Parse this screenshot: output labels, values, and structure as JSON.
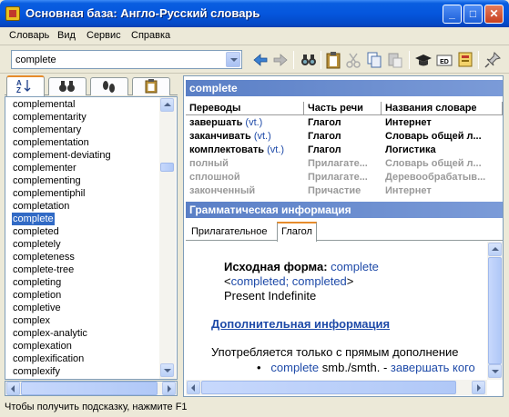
{
  "window": {
    "title": "Основная база: Англо-Русский словарь"
  },
  "menu": [
    "Словарь",
    "Вид",
    "Сервис",
    "Справка"
  ],
  "search": {
    "value": "complete"
  },
  "word_list": [
    "complemental",
    "complementarity",
    "complementary",
    "complementation",
    "complement-deviating",
    "complementer",
    "complementing",
    "complementiphil",
    "completation",
    "complete",
    "completed",
    "completely",
    "completeness",
    "complete-tree",
    "completing",
    "completion",
    "completive",
    "complex",
    "complex-analytic",
    "complexation",
    "complexification",
    "complexify"
  ],
  "selected_word": "complete",
  "translation": {
    "header": "complete",
    "columns": [
      "Переводы",
      "Часть речи",
      "Названия словаре"
    ],
    "rows": [
      {
        "word": "завершать",
        "tag": "(vt.)",
        "pos": "Глагол",
        "dict": "Интернет",
        "dim": false
      },
      {
        "word": "заканчивать",
        "tag": "(vt.)",
        "pos": "Глагол",
        "dict": "Словарь общей л...",
        "dim": false
      },
      {
        "word": "комплектовать",
        "tag": "(vt.)",
        "pos": "Глагол",
        "dict": "Логистика",
        "dim": false
      },
      {
        "word": "полный",
        "tag": "",
        "pos": "Прилагате...",
        "dict": "Словарь общей л...",
        "dim": true
      },
      {
        "word": "сплошной",
        "tag": "",
        "pos": "Прилагате...",
        "dict": "Деревообрабатыв...",
        "dim": true
      },
      {
        "word": "законченный",
        "tag": "",
        "pos": "Причастие",
        "dict": "Интернет",
        "dim": true
      }
    ]
  },
  "grammar": {
    "header": "Грамматическая информация",
    "tabs": [
      "Прилагательное",
      "Глагол"
    ],
    "active_tab": "Глагол",
    "base_form_label": "Исходная форма:",
    "base_form_value": "complete",
    "forms_open": "<",
    "forms_value": "completed; completed",
    "forms_close": ">",
    "tense": "Present Indefinite",
    "more_info": "Дополнительная информация",
    "usage_note": "Употребляется только с прямым дополнение",
    "example_en": "complete",
    "example_rest": "smb./smth. -",
    "example_ru": "завершать кого"
  },
  "status": {
    "hint": "Чтобы получить подсказку, нажмите F1"
  }
}
